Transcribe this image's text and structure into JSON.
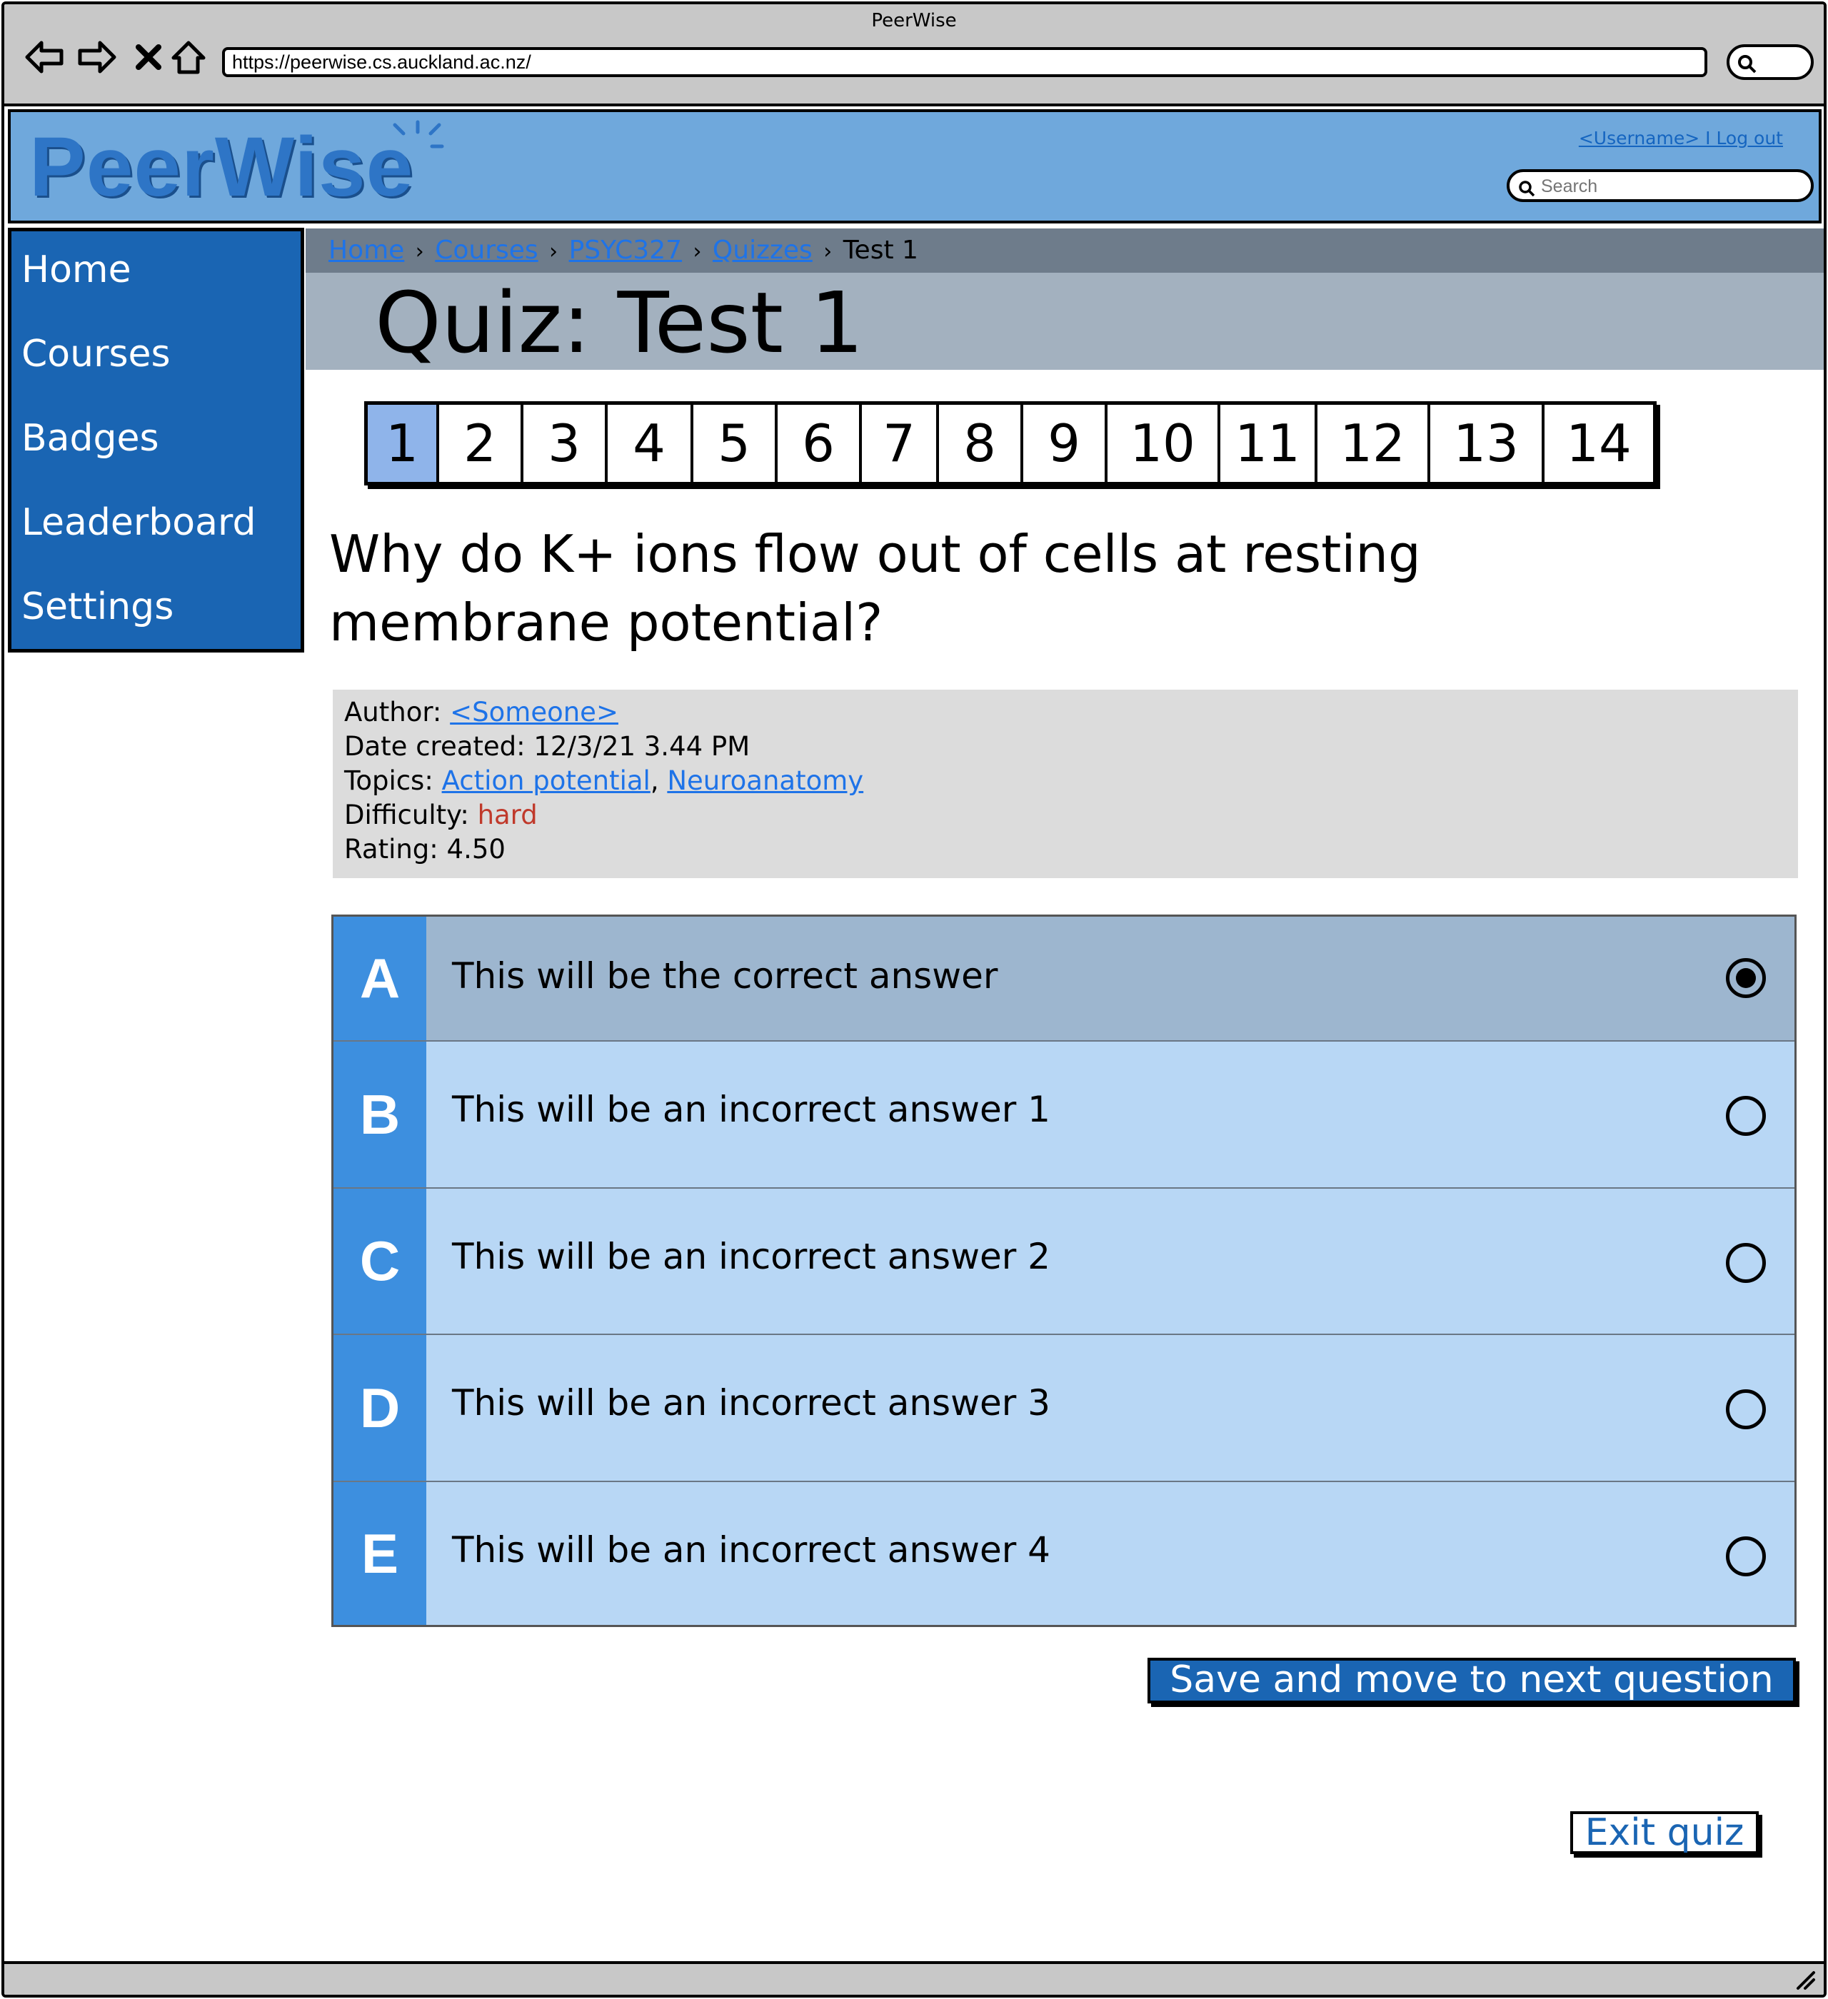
{
  "window": {
    "title": "PeerWise"
  },
  "browser": {
    "url": "https://peerwise.cs.auckland.ac.nz/",
    "icons": [
      "back-arrow-icon",
      "forward-arrow-icon",
      "stop-x-icon",
      "home-icon",
      "search-icon"
    ]
  },
  "header": {
    "logo": "PeerWise",
    "user_link": "<Username> I Log out",
    "search_placeholder": "Search"
  },
  "sidebar": {
    "items": [
      {
        "label": "Home"
      },
      {
        "label": "Courses"
      },
      {
        "label": "Badges"
      },
      {
        "label": "Leaderboard"
      },
      {
        "label": "Settings"
      }
    ]
  },
  "breadcrumb": {
    "items": [
      "Home",
      "Courses",
      "PSYC327",
      "Quizzes"
    ],
    "current": "Test 1",
    "separator": "›"
  },
  "page": {
    "title": "Quiz: Test 1"
  },
  "question_nav": {
    "numbers": [
      "1",
      "2",
      "3",
      "4",
      "5",
      "6",
      "7",
      "8",
      "9",
      "10",
      "11",
      "12",
      "13",
      "14"
    ],
    "active": "1"
  },
  "question": {
    "text": "Why do K+ ions flow out of cells at resting membrane potential?"
  },
  "meta": {
    "author_label": "Author:",
    "author": "<Someone>",
    "date_label": "Date created:",
    "date": "12/3/21 3.44 PM",
    "topics_label": "Topics:",
    "topics": [
      "Action potential",
      "Neuroanatomy"
    ],
    "topics_separator": ",",
    "difficulty_label": "Difficulty:",
    "difficulty": "hard",
    "rating_label": "Rating:",
    "rating": "4.50"
  },
  "answers": [
    {
      "letter": "A",
      "text": "This will be the correct answer",
      "selected": true
    },
    {
      "letter": "B",
      "text": "This will be an incorrect answer 1",
      "selected": false
    },
    {
      "letter": "C",
      "text": "This will be an incorrect answer 2",
      "selected": false
    },
    {
      "letter": "D",
      "text": "This will be an incorrect answer 3",
      "selected": false
    },
    {
      "letter": "E",
      "text": "This will be an incorrect answer 4",
      "selected": false
    }
  ],
  "actions": {
    "next_label": "Save and move to next question >",
    "exit_label": "Exit quiz"
  },
  "colors": {
    "header_bg": "#6fa8dc",
    "sidebar_bg": "#1a65b3",
    "link": "#1e73e8",
    "answer_letter_bg": "#3d8fdf",
    "answer_bg": "#b8d7f5",
    "answer_selected_bg": "#9db6cf",
    "difficulty_hard": "#c0392b"
  }
}
